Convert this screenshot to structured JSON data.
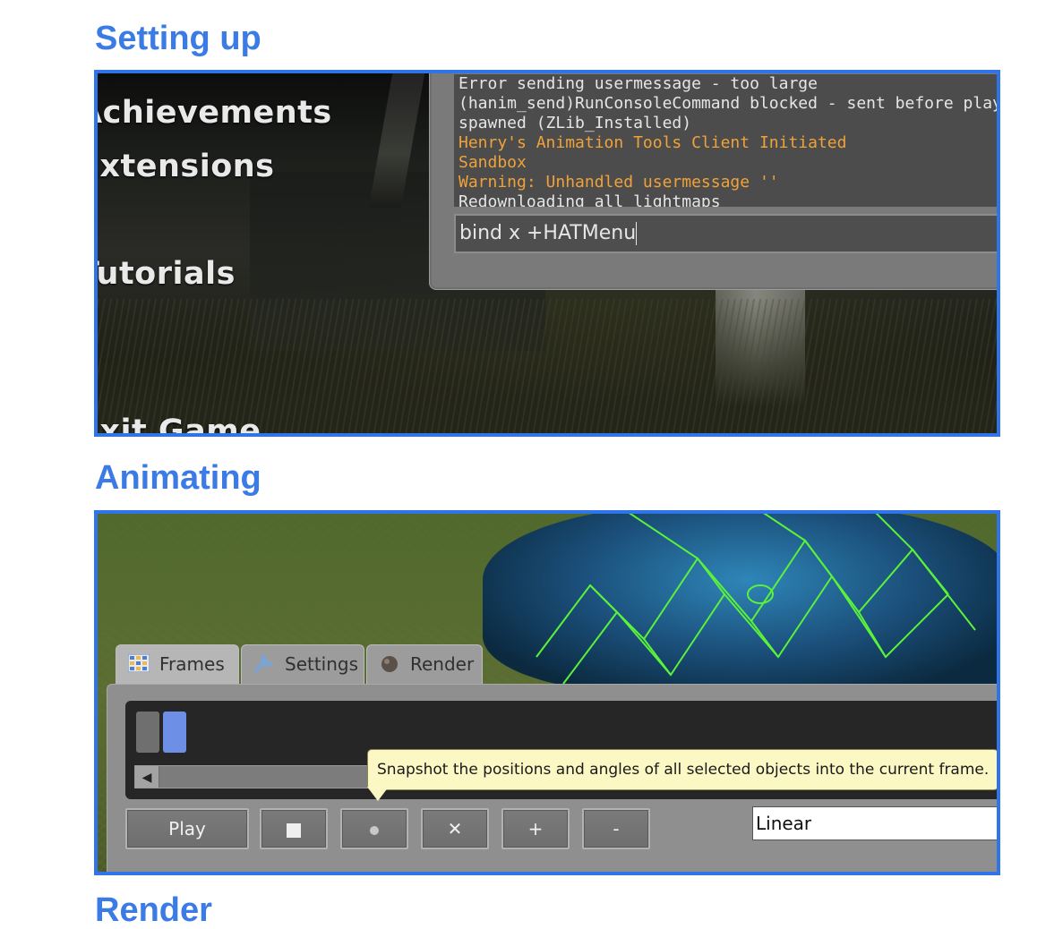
{
  "sections": {
    "setup_title": "Setting up",
    "animating_title": "Animating",
    "next_title_partial": "Render"
  },
  "game_menu": {
    "items": [
      "Achievements",
      "Extensions",
      "Tutorials",
      "Exit Game"
    ]
  },
  "console": {
    "lines": [
      {
        "text": "Error sending usermessage - too large",
        "color": "#e6e6e6"
      },
      {
        "text": "(hanim_send)RunConsoleCommand blocked - sent before player spawned (ZLib_Installed)",
        "color": "#e6e6e6"
      },
      {
        "text": "spawned (ZLib_Installed)",
        "color": "#e6e6e6"
      },
      {
        "text": "Henry's Animation Tools Client Initiated",
        "color": "#f0a23a"
      },
      {
        "text": "Sandbox",
        "color": "#f0a23a"
      },
      {
        "text": "Warning: Unhandled usermessage ''",
        "color": "#f0a23a"
      },
      {
        "text": "Redownloading all lightmaps",
        "color": "#e6e6e6"
      }
    ],
    "input_value": "bind x +HATMenu"
  },
  "hat_panel": {
    "tabs": [
      {
        "label": "Frames",
        "icon": "grid-icon",
        "active": true
      },
      {
        "label": "Settings",
        "icon": "wrench-icon",
        "active": false
      },
      {
        "label": "Render",
        "icon": "camera-icon",
        "active": false
      }
    ],
    "tooltip": "Snapshot the positions and angles of all selected objects into the current frame.",
    "buttons": {
      "play": "Play",
      "stop_icon": "stop-icon",
      "record_icon": "record-icon",
      "delete": "✕",
      "add": "+",
      "remove": "-"
    },
    "interpolation": "Linear",
    "frames": [
      {
        "color": "#6f6f6f",
        "selected": false
      },
      {
        "color": "#6d8fe6",
        "selected": true
      }
    ]
  },
  "colors": {
    "heading": "#3a7be6",
    "frame_border": "#2f74e8",
    "console_highlight": "#f0a23a"
  }
}
